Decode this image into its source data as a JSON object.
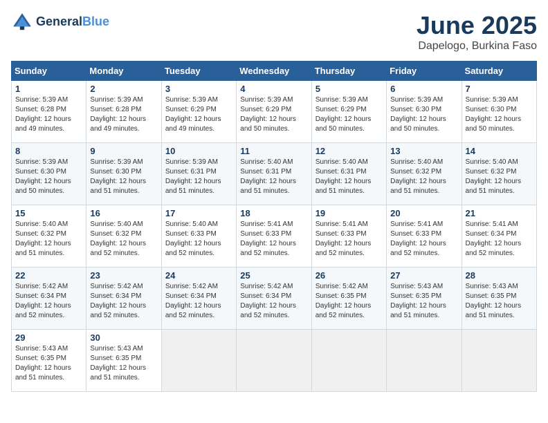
{
  "header": {
    "logo_line1": "General",
    "logo_line2": "Blue",
    "month": "June 2025",
    "location": "Dapelogo, Burkina Faso"
  },
  "days_of_week": [
    "Sunday",
    "Monday",
    "Tuesday",
    "Wednesday",
    "Thursday",
    "Friday",
    "Saturday"
  ],
  "weeks": [
    [
      {
        "day": "1",
        "sunrise": "5:39 AM",
        "sunset": "6:28 PM",
        "daylight": "12 hours and 49 minutes."
      },
      {
        "day": "2",
        "sunrise": "5:39 AM",
        "sunset": "6:28 PM",
        "daylight": "12 hours and 49 minutes."
      },
      {
        "day": "3",
        "sunrise": "5:39 AM",
        "sunset": "6:29 PM",
        "daylight": "12 hours and 49 minutes."
      },
      {
        "day": "4",
        "sunrise": "5:39 AM",
        "sunset": "6:29 PM",
        "daylight": "12 hours and 50 minutes."
      },
      {
        "day": "5",
        "sunrise": "5:39 AM",
        "sunset": "6:29 PM",
        "daylight": "12 hours and 50 minutes."
      },
      {
        "day": "6",
        "sunrise": "5:39 AM",
        "sunset": "6:30 PM",
        "daylight": "12 hours and 50 minutes."
      },
      {
        "day": "7",
        "sunrise": "5:39 AM",
        "sunset": "6:30 PM",
        "daylight": "12 hours and 50 minutes."
      }
    ],
    [
      {
        "day": "8",
        "sunrise": "5:39 AM",
        "sunset": "6:30 PM",
        "daylight": "12 hours and 50 minutes."
      },
      {
        "day": "9",
        "sunrise": "5:39 AM",
        "sunset": "6:30 PM",
        "daylight": "12 hours and 51 minutes."
      },
      {
        "day": "10",
        "sunrise": "5:39 AM",
        "sunset": "6:31 PM",
        "daylight": "12 hours and 51 minutes."
      },
      {
        "day": "11",
        "sunrise": "5:40 AM",
        "sunset": "6:31 PM",
        "daylight": "12 hours and 51 minutes."
      },
      {
        "day": "12",
        "sunrise": "5:40 AM",
        "sunset": "6:31 PM",
        "daylight": "12 hours and 51 minutes."
      },
      {
        "day": "13",
        "sunrise": "5:40 AM",
        "sunset": "6:32 PM",
        "daylight": "12 hours and 51 minutes."
      },
      {
        "day": "14",
        "sunrise": "5:40 AM",
        "sunset": "6:32 PM",
        "daylight": "12 hours and 51 minutes."
      }
    ],
    [
      {
        "day": "15",
        "sunrise": "5:40 AM",
        "sunset": "6:32 PM",
        "daylight": "12 hours and 51 minutes."
      },
      {
        "day": "16",
        "sunrise": "5:40 AM",
        "sunset": "6:32 PM",
        "daylight": "12 hours and 52 minutes."
      },
      {
        "day": "17",
        "sunrise": "5:40 AM",
        "sunset": "6:33 PM",
        "daylight": "12 hours and 52 minutes."
      },
      {
        "day": "18",
        "sunrise": "5:41 AM",
        "sunset": "6:33 PM",
        "daylight": "12 hours and 52 minutes."
      },
      {
        "day": "19",
        "sunrise": "5:41 AM",
        "sunset": "6:33 PM",
        "daylight": "12 hours and 52 minutes."
      },
      {
        "day": "20",
        "sunrise": "5:41 AM",
        "sunset": "6:33 PM",
        "daylight": "12 hours and 52 minutes."
      },
      {
        "day": "21",
        "sunrise": "5:41 AM",
        "sunset": "6:34 PM",
        "daylight": "12 hours and 52 minutes."
      }
    ],
    [
      {
        "day": "22",
        "sunrise": "5:42 AM",
        "sunset": "6:34 PM",
        "daylight": "12 hours and 52 minutes."
      },
      {
        "day": "23",
        "sunrise": "5:42 AM",
        "sunset": "6:34 PM",
        "daylight": "12 hours and 52 minutes."
      },
      {
        "day": "24",
        "sunrise": "5:42 AM",
        "sunset": "6:34 PM",
        "daylight": "12 hours and 52 minutes."
      },
      {
        "day": "25",
        "sunrise": "5:42 AM",
        "sunset": "6:34 PM",
        "daylight": "12 hours and 52 minutes."
      },
      {
        "day": "26",
        "sunrise": "5:42 AM",
        "sunset": "6:35 PM",
        "daylight": "12 hours and 52 minutes."
      },
      {
        "day": "27",
        "sunrise": "5:43 AM",
        "sunset": "6:35 PM",
        "daylight": "12 hours and 51 minutes."
      },
      {
        "day": "28",
        "sunrise": "5:43 AM",
        "sunset": "6:35 PM",
        "daylight": "12 hours and 51 minutes."
      }
    ],
    [
      {
        "day": "29",
        "sunrise": "5:43 AM",
        "sunset": "6:35 PM",
        "daylight": "12 hours and 51 minutes."
      },
      {
        "day": "30",
        "sunrise": "5:43 AM",
        "sunset": "6:35 PM",
        "daylight": "12 hours and 51 minutes."
      },
      null,
      null,
      null,
      null,
      null
    ]
  ],
  "labels": {
    "sunrise": "Sunrise:",
    "sunset": "Sunset:",
    "daylight": "Daylight:"
  }
}
